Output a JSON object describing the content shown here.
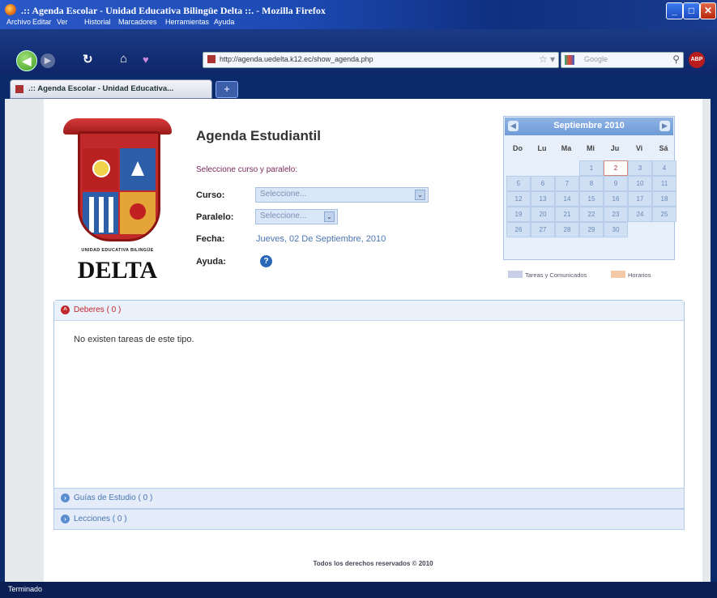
{
  "window": {
    "title": ".:: Agenda Escolar - Unidad Educativa Bilingüe Delta ::. - Mozilla Firefox"
  },
  "menu": [
    "Archivo",
    "Editar",
    "Ver",
    "Historial",
    "Marcadores",
    "Herramientas",
    "Ayuda"
  ],
  "nav": {
    "url": "http://agenda.uedelta.k12.ec/show_agenda.php",
    "search_placeholder": "Google",
    "addon": "ABP"
  },
  "tab": {
    "label": ".:: Agenda Escolar - Unidad Educativa..."
  },
  "school": {
    "name_small": "UNIDAD EDUCATIVA BILINGÜE",
    "name_big": "DELTA"
  },
  "form": {
    "heading": "Agenda Estudiantil",
    "instruction": "Seleccione curso y paralelo:",
    "curso_label": "Curso:",
    "curso_value": "Seleccione...",
    "paralelo_label": "Paralelo:",
    "paralelo_value": "Seleccione...",
    "fecha_label": "Fecha:",
    "fecha_value": "Jueves, 02 De Septiembre, 2010",
    "ayuda_label": "Ayuda:"
  },
  "calendar": {
    "title": "Septiembre 2010",
    "weekdays": [
      "Do",
      "Lu",
      "Ma",
      "Mi",
      "Ju",
      "Vi",
      "Sá"
    ],
    "weeks": [
      [
        "",
        "",
        "",
        "1",
        "2",
        "3",
        "4"
      ],
      [
        "5",
        "6",
        "7",
        "8",
        "9",
        "10",
        "11"
      ],
      [
        "12",
        "13",
        "14",
        "15",
        "16",
        "17",
        "18"
      ],
      [
        "19",
        "20",
        "21",
        "22",
        "23",
        "24",
        "25"
      ],
      [
        "26",
        "27",
        "28",
        "29",
        "30",
        "",
        ""
      ]
    ],
    "today": "2",
    "legend": [
      {
        "label": "Tareas y Comunicados",
        "color": "#c9cfe6"
      },
      {
        "label": "Horarios",
        "color": "#f4c9a8"
      }
    ]
  },
  "panels": {
    "deberes": {
      "title": "Deberes ( 0 )",
      "empty_text": "No existen tareas de este tipo."
    },
    "guias": {
      "title": "Guías de Estudio ( 0 )"
    },
    "lecciones": {
      "title": "Lecciones ( 0 )"
    }
  },
  "footer": "Todos los derechos reservados © 2010",
  "status": "Terminado",
  "colors": {
    "accent": "#4a74b1",
    "deberes_red": "#c0262a",
    "panel_blue": "#5a8ed0"
  }
}
